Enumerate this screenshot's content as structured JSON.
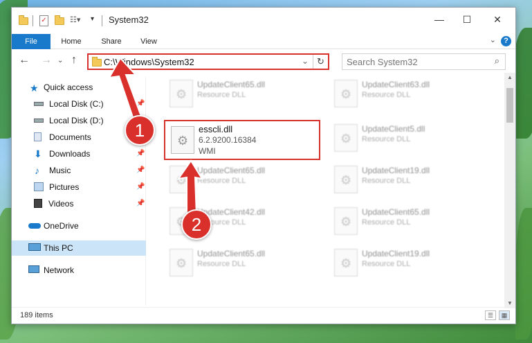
{
  "window": {
    "title": "System32"
  },
  "ribbon": {
    "tabs": [
      "File",
      "Home",
      "Share",
      "View"
    ],
    "help": "?"
  },
  "address": {
    "path": "C:\\Windows\\System32"
  },
  "search": {
    "placeholder": "Search System32"
  },
  "sidebar": {
    "items": [
      {
        "label": "Quick access",
        "icon": "star-icon",
        "pinned": false
      },
      {
        "label": "Local Disk (C:)",
        "icon": "drive-icon",
        "pinned": true
      },
      {
        "label": "Local Disk (D:)",
        "icon": "drive-icon",
        "pinned": false
      },
      {
        "label": "Documents",
        "icon": "documents-icon",
        "pinned": true
      },
      {
        "label": "Downloads",
        "icon": "download-icon",
        "pinned": true
      },
      {
        "label": "Music",
        "icon": "music-icon",
        "pinned": true
      },
      {
        "label": "Pictures",
        "icon": "pictures-icon",
        "pinned": true
      },
      {
        "label": "Videos",
        "icon": "videos-icon",
        "pinned": true
      },
      {
        "label": "OneDrive",
        "icon": "onedrive-icon",
        "pinned": false
      },
      {
        "label": "This PC",
        "icon": "computer-icon",
        "pinned": false,
        "selected": true
      },
      {
        "label": "Network",
        "icon": "network-icon",
        "pinned": false
      }
    ]
  },
  "files": {
    "left": [
      {
        "name": "UpdateClient65.dll",
        "desc": "Resource DLL"
      },
      {
        "name": "esscli.dll",
        "desc": "6.2.9200.16384",
        "desc2": "WMI",
        "highlighted": true
      },
      {
        "name": "UpdateClient65.dll",
        "desc": "Resource DLL"
      },
      {
        "name": "UpdateClient42.dll",
        "desc": "Resource DLL"
      },
      {
        "name": "UpdateClient65.dll",
        "desc": "Resource DLL"
      }
    ],
    "right": [
      {
        "name": "UpdateClient63.dll",
        "desc": "Resource DLL"
      },
      {
        "name": "UpdateClient5.dll",
        "desc": "Resource DLL"
      },
      {
        "name": "UpdateClient19.dll",
        "desc": "Resource DLL"
      },
      {
        "name": "UpdateClient65.dll",
        "desc": "Resource DLL"
      },
      {
        "name": "UpdateClient19.dll",
        "desc": "Resource DLL"
      }
    ]
  },
  "status": {
    "count": "189 items"
  },
  "annotations": {
    "step1": "1",
    "step2": "2"
  },
  "colors": {
    "accent": "#1979ca",
    "highlight": "#d9302c",
    "selected": "#cce4f7"
  }
}
